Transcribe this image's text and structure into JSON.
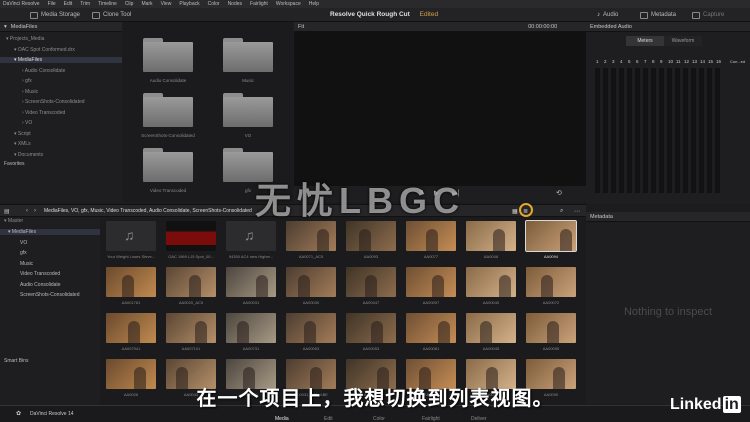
{
  "menubar": {
    "items": [
      "DaVinci Resolve",
      "File",
      "Edit",
      "Trim",
      "Timeline",
      "Clip",
      "Mark",
      "View",
      "Playback",
      "Color",
      "Nodes",
      "Fairlight",
      "Workspace",
      "Help"
    ]
  },
  "toolbar": {
    "media_storage": "Media Storage",
    "clone_tool": "Clone Tool",
    "project_title": "Resolve Quick Rough Cut",
    "edited": "Edited",
    "audio": "Audio",
    "metadata": "Metadata",
    "capture": "Capture"
  },
  "storage": {
    "header": "MediaFiles",
    "tree": [
      {
        "label": "Projects_Media",
        "indent": 0
      },
      {
        "label": "OAC Spot Conformed.drx",
        "indent": 1
      },
      {
        "label": "MediaFiles",
        "indent": 1,
        "selected": true
      },
      {
        "label": "Audio Consolidate",
        "indent": 2
      },
      {
        "label": "gfx",
        "indent": 2
      },
      {
        "label": "Music",
        "indent": 2
      },
      {
        "label": "ScreenShots-Consolidated",
        "indent": 2
      },
      {
        "label": "Video Transcoded",
        "indent": 2
      },
      {
        "label": "VO",
        "indent": 2
      },
      {
        "label": "Script",
        "indent": 1
      },
      {
        "label": "XMLs",
        "indent": 1
      },
      {
        "label": "Documents",
        "indent": 1
      }
    ],
    "favorites": "Favorites"
  },
  "folders": [
    {
      "label": "Audio Consolidate"
    },
    {
      "label": "Music"
    },
    {
      "label": "ScreenShots-Consolidated"
    },
    {
      "label": "VO"
    },
    {
      "label": "Video Transcoded"
    },
    {
      "label": "gfx"
    }
  ],
  "viewer": {
    "fit": "Fit",
    "timecode": "00:00:00:00"
  },
  "audio": {
    "header": "Embedded Audio",
    "tabs": [
      "Meters",
      "Waveform"
    ],
    "channels": [
      "1",
      "2",
      "3",
      "4",
      "5",
      "6",
      "7",
      "8",
      "9",
      "10",
      "11",
      "12",
      "13",
      "14",
      "15",
      "16"
    ],
    "combo": "Con...ed"
  },
  "media_pool": {
    "path": "MediaFiles, VO, gfx, Music, Video Transcoded, Audio Consolidate, ScreenShots-Consolidated",
    "master": "Master",
    "bins": [
      "MediaFiles",
      "VO",
      "gfx",
      "Music",
      "Video Transcoded",
      "Audio Consolidate",
      "ScreenShots-Consolidated"
    ],
    "smart_bins": "Smart Bins"
  },
  "clips": [
    {
      "label": "Your Weight Loses Steve...",
      "kind": "audio"
    },
    {
      "label": "OAC 1969 LJ5 Spot_00...",
      "kind": "red"
    },
    {
      "label": "94350 AC4 new Higher...",
      "kind": "audio"
    },
    {
      "label": "AA0071_AC5",
      "kind": "video"
    },
    {
      "label": "AA0093",
      "kind": "video"
    },
    {
      "label": "AA0077",
      "kind": "video"
    },
    {
      "label": "AA0048",
      "kind": "video"
    },
    {
      "label": "AA0094",
      "kind": "video",
      "selected": true
    },
    {
      "label": "AA001781",
      "kind": "video"
    },
    {
      "label": "AA0020_AC5",
      "kind": "video"
    },
    {
      "label": "AA00031",
      "kind": "video"
    },
    {
      "label": "AA00030",
      "kind": "video"
    },
    {
      "label": "AA00447",
      "kind": "video"
    },
    {
      "label": "AA00007",
      "kind": "video"
    },
    {
      "label": "AA00040",
      "kind": "video"
    },
    {
      "label": "AA00072",
      "kind": "video"
    },
    {
      "label": "AA007941",
      "kind": "video"
    },
    {
      "label": "AA007101",
      "kind": "video"
    },
    {
      "label": "AA00731",
      "kind": "video"
    },
    {
      "label": "AA00053",
      "kind": "video"
    },
    {
      "label": "AA00053",
      "kind": "video"
    },
    {
      "label": "AA00081",
      "kind": "video"
    },
    {
      "label": "AA00045",
      "kind": "video"
    },
    {
      "label": "AA00095",
      "kind": "video"
    },
    {
      "label": "AA0026",
      "kind": "video"
    },
    {
      "label": "AA0043",
      "kind": "video"
    },
    {
      "label": "AA0031",
      "kind": "video"
    },
    {
      "label": "AA0031_A01_ABE",
      "kind": "video"
    },
    {
      "label": "AA0029",
      "kind": "video"
    },
    {
      "label": "AA0041",
      "kind": "video"
    },
    {
      "label": "AA0049",
      "kind": "video"
    },
    {
      "label": "AA0090",
      "kind": "video"
    }
  ],
  "metadata_panel": {
    "header": "Metadata",
    "empty": "Nothing to inspect"
  },
  "pages": [
    "Media",
    "Edit",
    "Color",
    "Fairlight",
    "Deliver"
  ],
  "app_name": "DaVinci Resolve 14",
  "subtitle": "在一个项目上，我想切换到列表视图。",
  "watermark": "无忧LBGC",
  "brand": {
    "linked": "Linked",
    "in": "in"
  }
}
